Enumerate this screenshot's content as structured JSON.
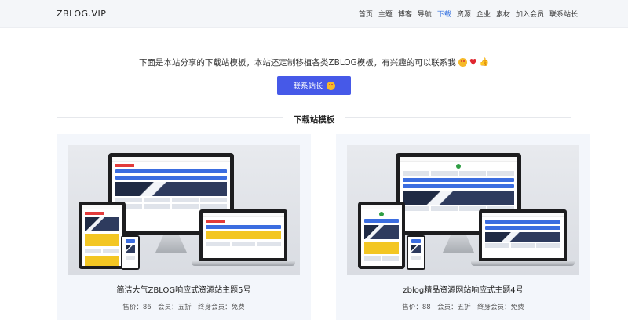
{
  "header": {
    "logo": "ZBLOG.VIP",
    "nav": [
      {
        "label": "首页",
        "active": false
      },
      {
        "label": "主题",
        "active": false
      },
      {
        "label": "博客",
        "active": false
      },
      {
        "label": "导航",
        "active": false
      },
      {
        "label": "下载",
        "active": true
      },
      {
        "label": "资源",
        "active": false
      },
      {
        "label": "企业",
        "active": false
      },
      {
        "label": "素材",
        "active": false
      },
      {
        "label": "加入会员",
        "active": false
      },
      {
        "label": "联系站长",
        "active": false
      }
    ]
  },
  "hero": {
    "text": "下面是本站分享的下载站模板，本站还定制移植各类ZBLOG模板，有兴趣的可以联系我",
    "icons": [
      "star-struck-face-icon",
      "heart-icon",
      "thumbs-up-icon"
    ],
    "button_label": "联系站长",
    "button_icon": "smiley-face-icon"
  },
  "section": {
    "title": "下载站模板"
  },
  "cards": [
    {
      "title": "简洁大气ZBLOG响应式资源站主题5号",
      "meta": "售价：86　会员：五折　终身会员：免费"
    },
    {
      "title": "zblog精品资源网站响应式主题4号",
      "meta": "售价：88　会员：五折　终身会员：免费"
    }
  ],
  "colors": {
    "accent": "#4659e8",
    "nav_active": "#2d6cdf",
    "topbar_bg": "#f4f6f9",
    "card_bg": "#f3f6fb"
  }
}
